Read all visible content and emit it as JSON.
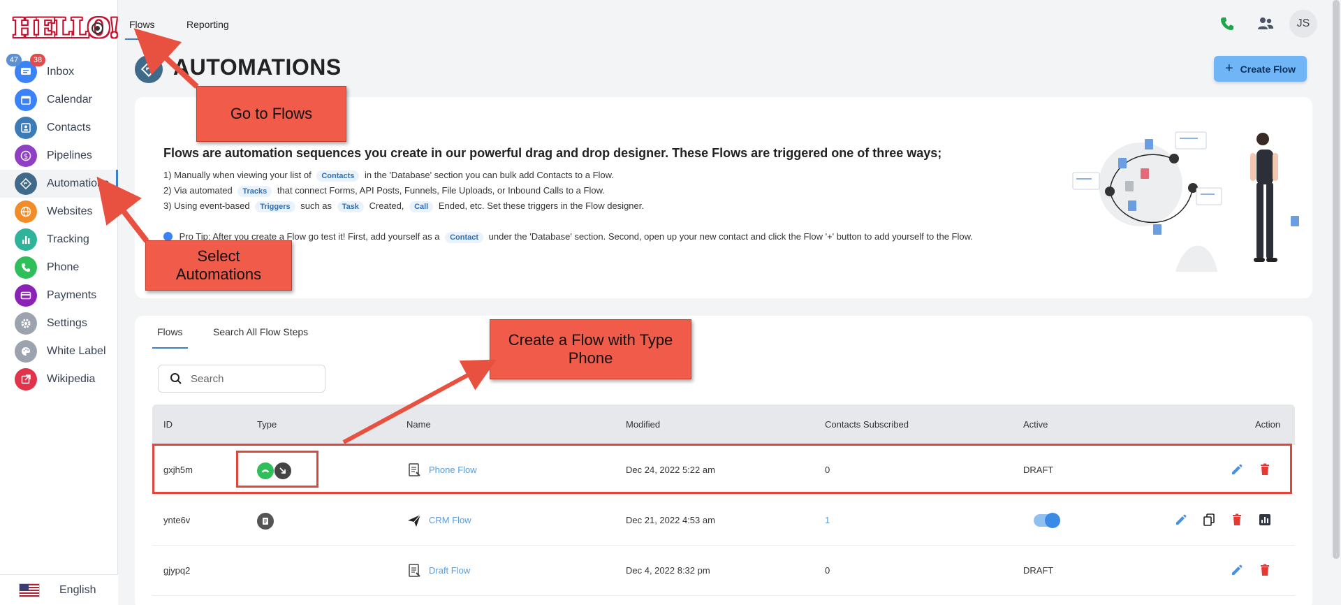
{
  "brand": {
    "logo_text": "HELLO!"
  },
  "sidebar": {
    "items": [
      {
        "label": "Inbox",
        "icon": "chat-icon",
        "color": "#3b82f6"
      },
      {
        "label": "Calendar",
        "icon": "calendar-icon",
        "color": "#3b82f6"
      },
      {
        "label": "Contacts",
        "icon": "contact-card-icon",
        "color": "#3b7bb8"
      },
      {
        "label": "Pipelines",
        "icon": "dollar-icon",
        "color": "#8e3fc4"
      },
      {
        "label": "Automations",
        "icon": "automation-icon",
        "color": "#3f6a8a"
      },
      {
        "label": "Websites",
        "icon": "globe-icon",
        "color": "#f28c28"
      },
      {
        "label": "Tracking",
        "icon": "bar-chart-icon",
        "color": "#2fb39a"
      },
      {
        "label": "Phone",
        "icon": "phone-icon",
        "color": "#2fbf5a"
      },
      {
        "label": "Payments",
        "icon": "credit-card-icon",
        "color": "#8b22b8"
      },
      {
        "label": "Settings",
        "icon": "gear-icon",
        "color": "#9ca3af"
      },
      {
        "label": "White Label",
        "icon": "palette-icon",
        "color": "#9ca3af"
      },
      {
        "label": "Wikipedia",
        "icon": "external-link-icon",
        "color": "#e1344a"
      }
    ],
    "inbox_badge_blue": "47",
    "inbox_badge_red": "38",
    "language": "English"
  },
  "topbar": {
    "tabs": [
      "Flows",
      "Reporting"
    ],
    "avatar_initials": "JS"
  },
  "page": {
    "title": "AUTOMATIONS",
    "create_button": "Create Flow"
  },
  "intro": {
    "title": "Flows are automation sequences you create in our powerful drag and drop designer. These Flows are triggered one of three ways;",
    "line1_a": "1) Manually when viewing your list of",
    "line1_chip": "Contacts",
    "line1_b": "in the 'Database' section you can bulk add Contacts to a Flow.",
    "line2_a": "2) Via automated",
    "line2_chip": "Tracks",
    "line2_b": "that connect Forms, API Posts, Funnels, File Uploads, or Inbound Calls to a Flow.",
    "line3_a": "3) Using event-based",
    "line3_chip1": "Triggers",
    "line3_b": "such as",
    "line3_chip2": "Task",
    "line3_c": "Created,",
    "line3_chip3": "Call",
    "line3_d": "Ended, etc. Set these triggers in the Flow designer.",
    "tip_a": "Pro Tip: After you create a Flow go test it! First, add yourself as a",
    "tip_chip": "Contact",
    "tip_b": "under the 'Database' section. Second, open up your new contact and click the Flow '+' button to add yourself to the Flow."
  },
  "flows": {
    "tabs": [
      "Flows",
      "Search All Flow Steps"
    ],
    "search_placeholder": "Search",
    "columns": [
      "ID",
      "Type",
      "Name",
      "Modified",
      "Contacts Subscribed",
      "Active",
      "Action"
    ],
    "rows": [
      {
        "id": "gxjh5m",
        "type": "phone",
        "name": "Phone Flow",
        "modified": "Dec 24, 2022 5:22 am",
        "contacts": "0",
        "active": "DRAFT"
      },
      {
        "id": "ynte6v",
        "type": "crm",
        "name": "CRM Flow",
        "modified": "Dec 21, 2022 4:53 am",
        "contacts": "1",
        "active": ""
      },
      {
        "id": "gjypq2",
        "type": "draft",
        "name": "Draft Flow",
        "modified": "Dec 4, 2022 8:32 pm",
        "contacts": "0",
        "active": "DRAFT"
      }
    ]
  },
  "callouts": {
    "go_to_flows": "Go to Flows",
    "select_automations": "Select Automations",
    "create_phone_flow": "Create a Flow with Type Phone"
  }
}
